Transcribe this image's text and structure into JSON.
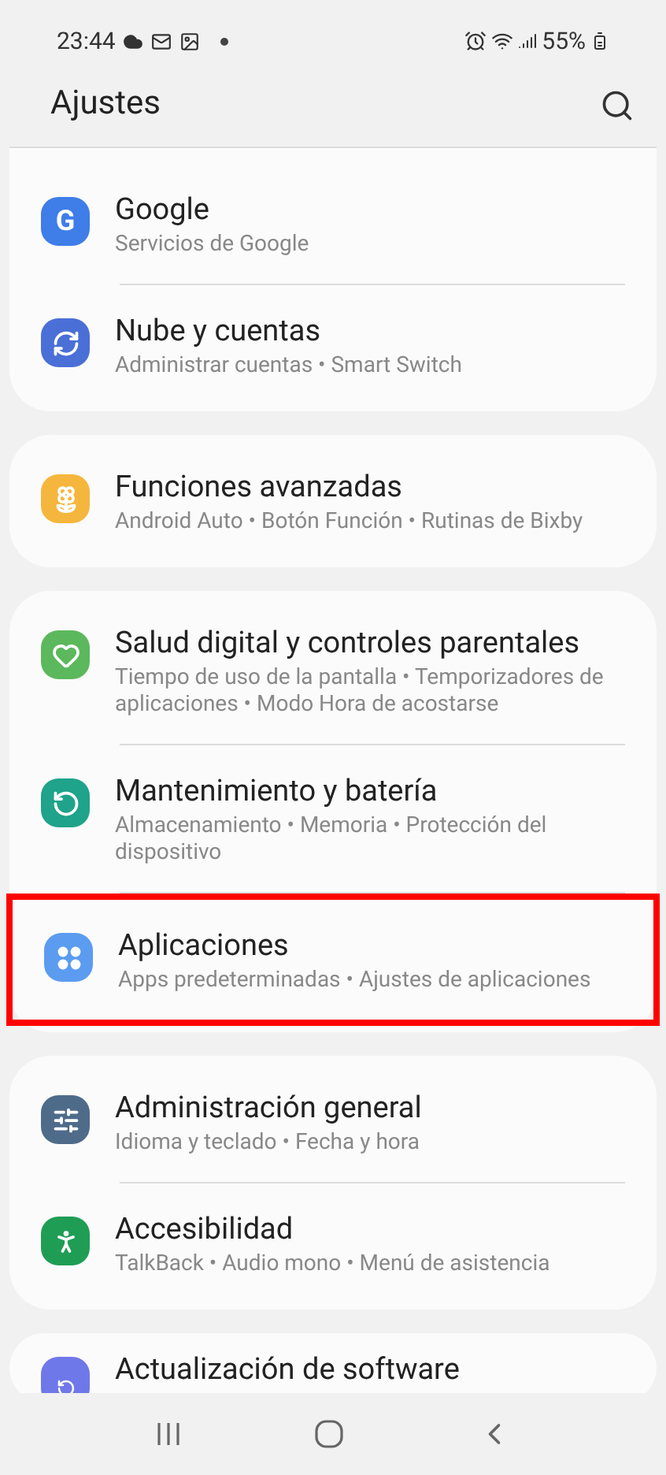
{
  "status_bar": {
    "time": "23:44",
    "battery": "55%"
  },
  "header": {
    "title": "Ajustes"
  },
  "groups": [
    {
      "items": [
        {
          "kind": "google",
          "icon_text": "G",
          "color": "#3f7de8",
          "title": "Google",
          "subtitle": "Servicios de Google",
          "highlighted": false
        },
        {
          "kind": "sync",
          "color": "#4a6fd6",
          "title": "Nube y cuentas",
          "subtitle": "Administrar cuentas • Smart Switch",
          "highlighted": false
        }
      ]
    },
    {
      "items": [
        {
          "kind": "flower",
          "color": "#f5b63d",
          "title": "Funciones avanzadas",
          "subtitle": "Android Auto • Botón Función • Rutinas de Bixby",
          "highlighted": false
        }
      ]
    },
    {
      "items": [
        {
          "kind": "heart",
          "color": "#5cb85c",
          "title": "Salud digital y controles parentales",
          "subtitle": "Tiempo de uso de la pantalla • Temporizadores de aplicaciones • Modo Hora de acostarse",
          "highlighted": false
        },
        {
          "kind": "refresh",
          "color": "#1fa38a",
          "title": "Mantenimiento y batería",
          "subtitle": "Almacenamiento • Memoria • Protección del dispositivo",
          "highlighted": false
        },
        {
          "kind": "dots",
          "color": "#5b9cf0",
          "title": "Aplicaciones",
          "subtitle": "Apps predeterminadas • Ajustes de aplicaciones",
          "highlighted": true
        }
      ]
    },
    {
      "items": [
        {
          "kind": "sliders",
          "color": "#4f6b8a",
          "title": "Administración general",
          "subtitle": "Idioma y teclado • Fecha y hora",
          "highlighted": false
        },
        {
          "kind": "person",
          "color": "#1f9d55",
          "title": "Accesibilidad",
          "subtitle": "TalkBack • Audio mono • Menú de asistencia",
          "highlighted": false
        }
      ]
    },
    {
      "items": [
        {
          "kind": "update",
          "color": "#6f78e8",
          "title": "Actualización de software",
          "highlighted": false
        }
      ]
    }
  ]
}
